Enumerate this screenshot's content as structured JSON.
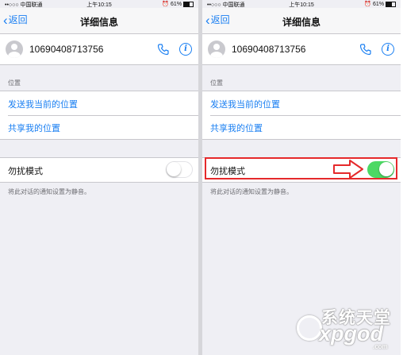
{
  "status": {
    "carrier": "••○○○ 中国联通",
    "time": "上午10:15",
    "battery": "61%",
    "battery_level": 0.61
  },
  "nav": {
    "back_label": "返回",
    "title": "详细信息"
  },
  "contact": {
    "number": "10690408713756"
  },
  "location": {
    "section_label": "位置",
    "send_location": "发送我当前的位置",
    "share_location": "共享我的位置"
  },
  "dnd": {
    "label": "勿扰模式",
    "footnote": "将此对话的通知设置为静音。"
  },
  "panels": [
    {
      "id": "before",
      "dnd_on": false
    },
    {
      "id": "after",
      "dnd_on": true
    }
  ],
  "colors": {
    "accent": "#1a7ff2",
    "toggle_on": "#4cd964",
    "highlight": "#e5292b"
  },
  "watermark": {
    "line1": "系统天堂",
    "line2": "xpgod",
    "line3": ".com"
  }
}
